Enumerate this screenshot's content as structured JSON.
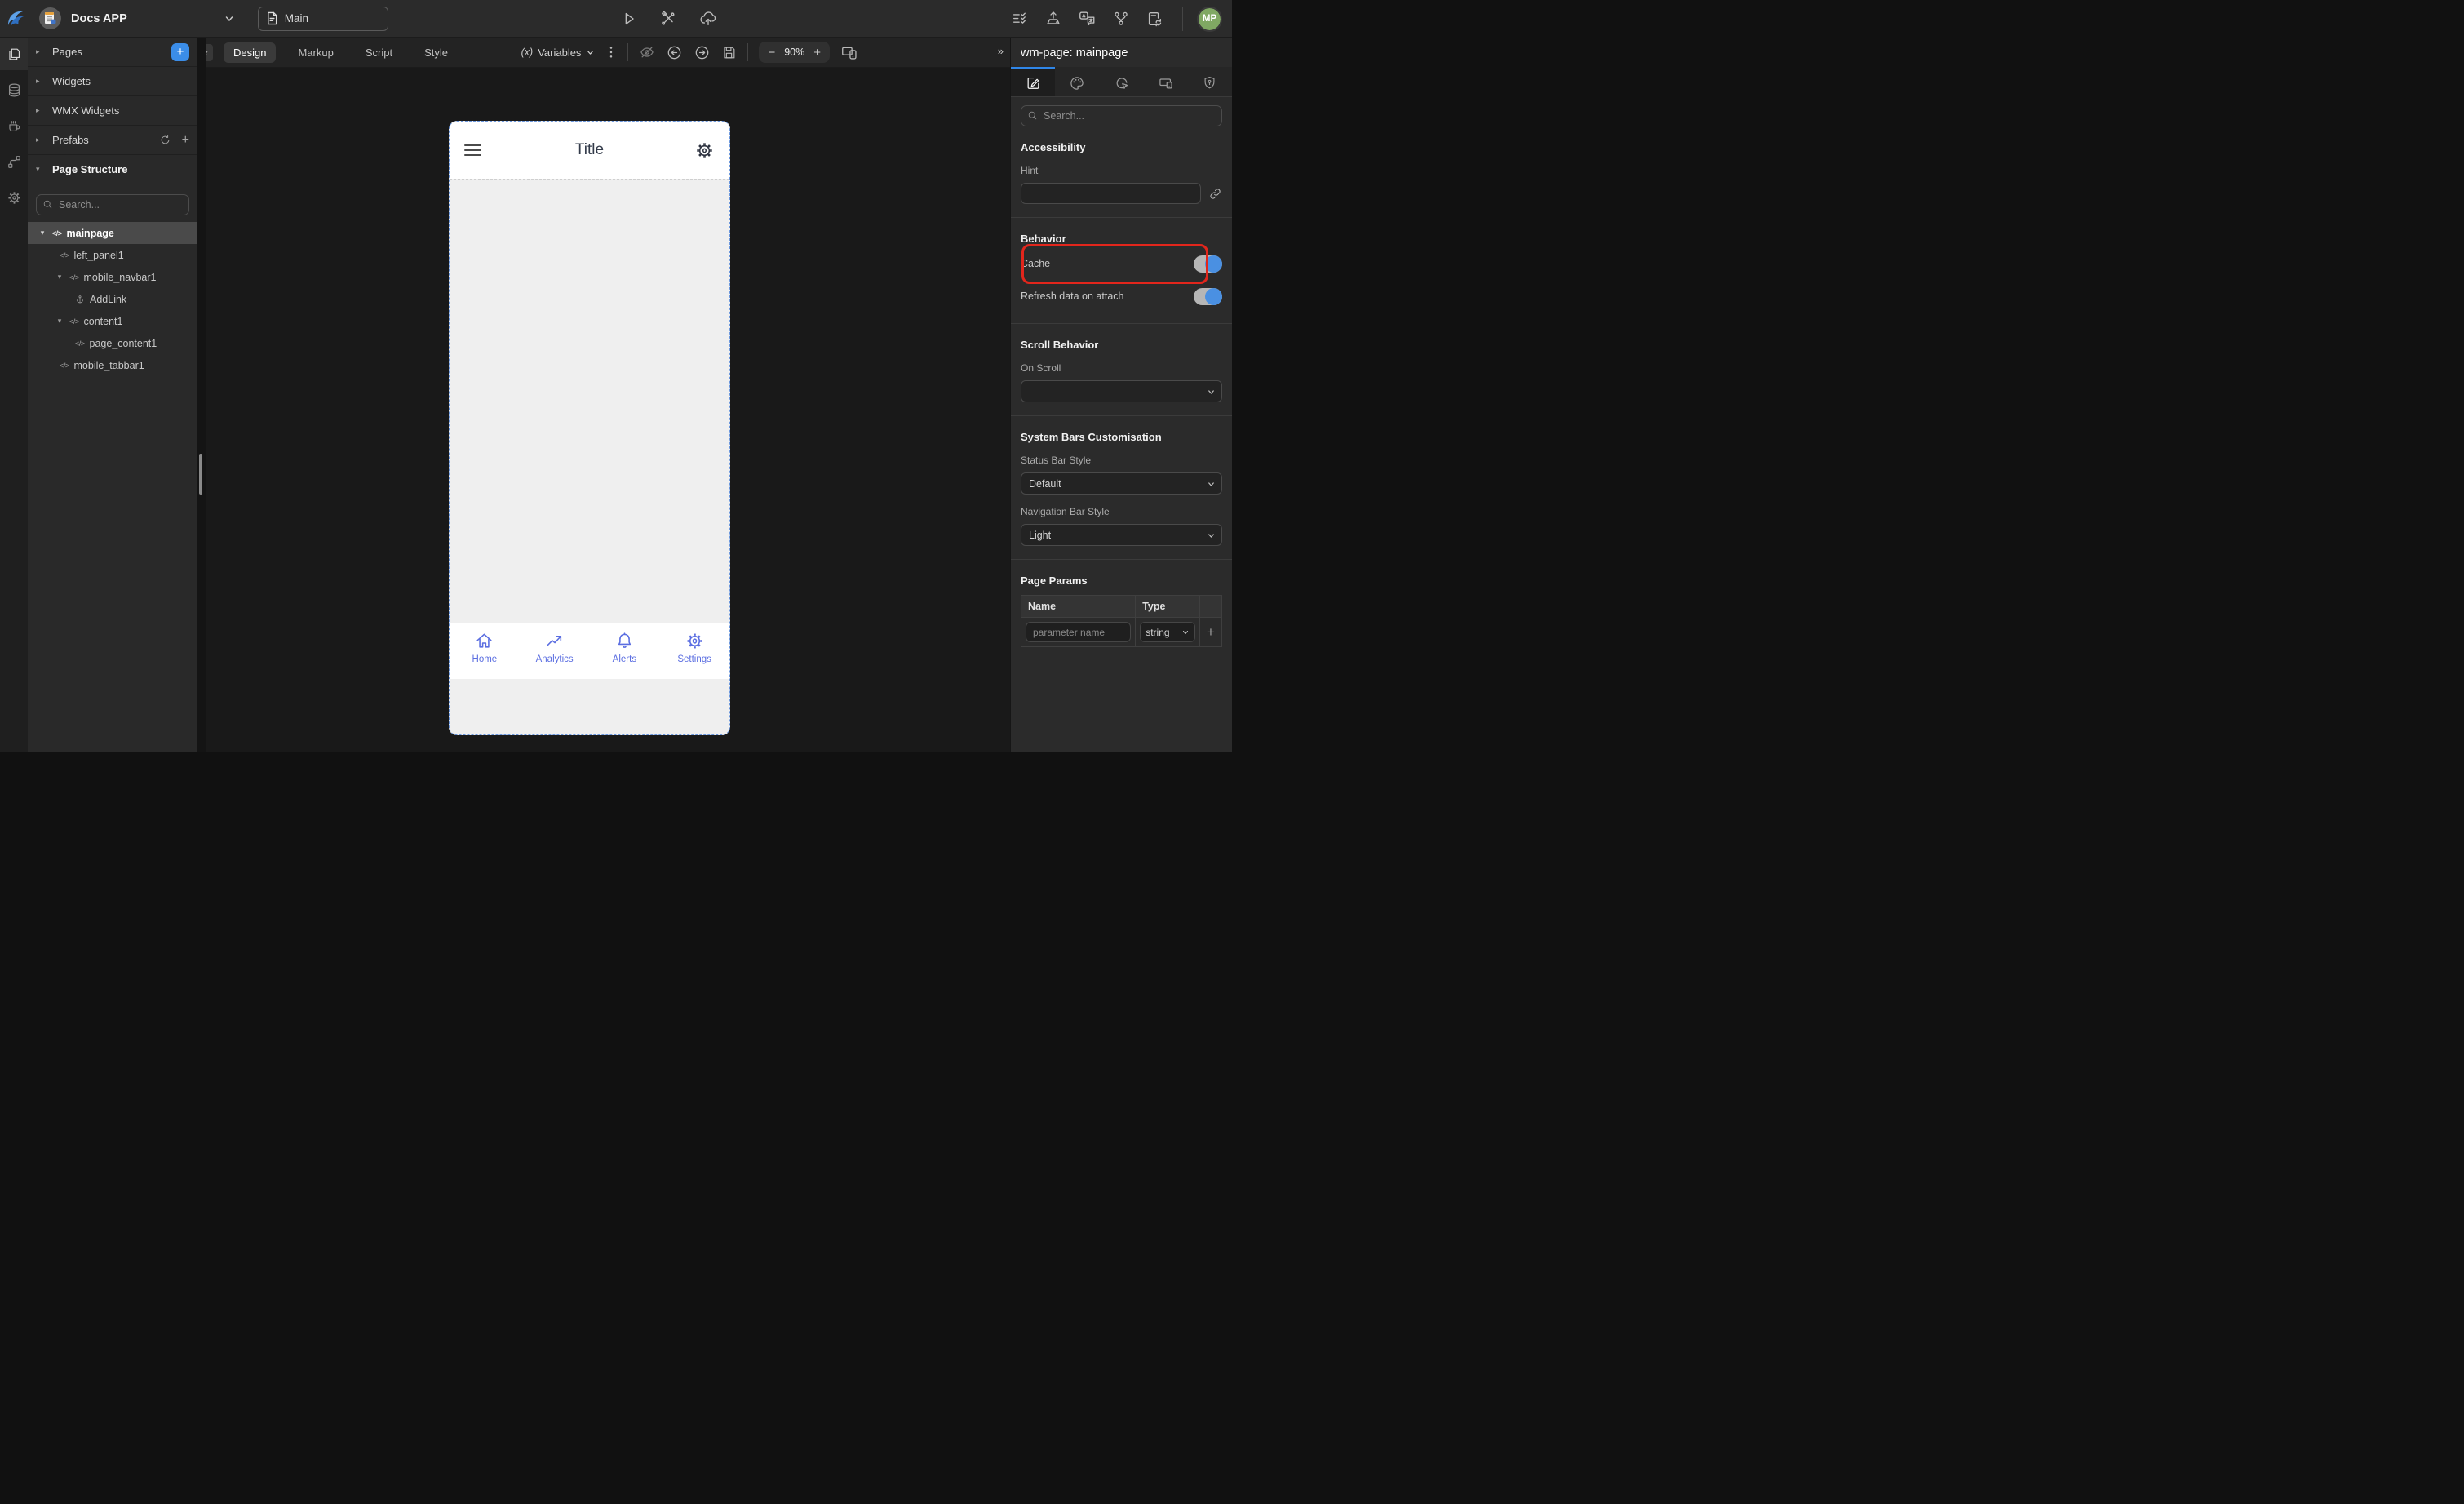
{
  "topbar": {
    "app_name": "Docs APP",
    "page_selector_label": "Main"
  },
  "user": {
    "initials": "MP"
  },
  "left_panel": {
    "sections": [
      {
        "label": "Pages"
      },
      {
        "label": "Widgets"
      },
      {
        "label": "WMX Widgets"
      },
      {
        "label": "Prefabs"
      },
      {
        "label": "Page Structure"
      }
    ],
    "search_placeholder": "Search...",
    "tree": [
      {
        "label": "mainpage"
      },
      {
        "label": "left_panel1"
      },
      {
        "label": "mobile_navbar1"
      },
      {
        "label": "AddLink"
      },
      {
        "label": "content1"
      },
      {
        "label": "page_content1"
      },
      {
        "label": "mobile_tabbar1"
      }
    ]
  },
  "canvas_toolbar": {
    "tabs": [
      {
        "label": "Design"
      },
      {
        "label": "Markup"
      },
      {
        "label": "Script"
      },
      {
        "label": "Style"
      }
    ],
    "active_tab": "Design",
    "variables_label": "Variables",
    "zoom_level": "90%"
  },
  "phone": {
    "title": "Title",
    "tabbar": [
      {
        "label": "Home"
      },
      {
        "label": "Analytics"
      },
      {
        "label": "Alerts"
      },
      {
        "label": "Settings"
      }
    ]
  },
  "right_panel": {
    "title": "wm-page: mainpage",
    "search_placeholder": "Search...",
    "accessibility": {
      "heading": "Accessibility",
      "hint_label": "Hint",
      "hint_value": ""
    },
    "behavior": {
      "heading": "Behavior",
      "cache_label": "Cache",
      "cache_on": true,
      "refresh_label": "Refresh data on attach",
      "refresh_on": true
    },
    "scroll": {
      "heading": "Scroll Behavior",
      "on_scroll_label": "On Scroll",
      "on_scroll_value": ""
    },
    "system_bars": {
      "heading": "System Bars Customisation",
      "status_bar_label": "Status Bar Style",
      "status_bar_value": "Default",
      "nav_bar_label": "Navigation Bar Style",
      "nav_bar_value": "Light"
    },
    "page_params": {
      "heading": "Page Params",
      "name_header": "Name",
      "type_header": "Type",
      "name_placeholder": "parameter name",
      "type_value": "string"
    }
  },
  "glyphs": {
    "collapse": "«",
    "expand": "»",
    "kebab": "⋮",
    "caret_down": "▾",
    "caret_right": "▸",
    "code": "</>",
    "plus": "+",
    "minus": "−",
    "variables_icon": "(x)",
    "chevron_down": "⌄"
  },
  "colors": {
    "accent_blue": "#3b8de8",
    "tab_indicator_blue": "#2f86e8",
    "toggle_knob_blue": "#4a90e2",
    "highlight_red": "#e2261c",
    "phone_accent": "#5b6ee1",
    "avatar_green": "#80a863",
    "selection_dash_blue": "#6b97dd"
  }
}
